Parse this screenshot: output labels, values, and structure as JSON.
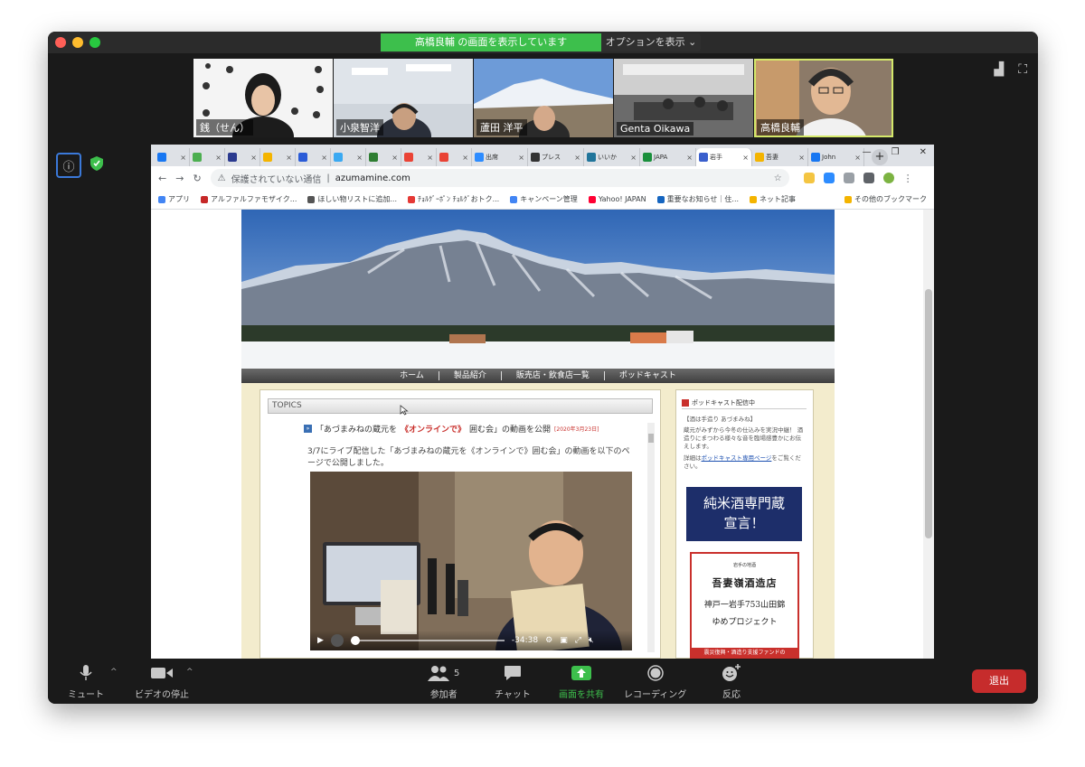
{
  "zoom": {
    "share_banner": "高橋良輔 の画面を表示しています",
    "options_label": "オプションを表示 ⌄",
    "participants": [
      {
        "name": "銭（せん）"
      },
      {
        "name": "小泉智洋"
      },
      {
        "name": "蘆田 洋平"
      },
      {
        "name": "Genta Oikawa"
      },
      {
        "name": "高橋良輔"
      }
    ],
    "toolbar": {
      "mute_label": "ミュート",
      "video_label": "ビデオの停止",
      "participants_label": "参加者",
      "participants_count": "5",
      "chat_label": "チャット",
      "share_label": "画面を共有",
      "record_label": "レコーディング",
      "react_label": "反応",
      "leave_label": "退出"
    }
  },
  "browser": {
    "tabs": [
      {
        "label": "",
        "color": "#1877f2"
      },
      {
        "label": "",
        "color": "#4caf50"
      },
      {
        "label": "",
        "color": "#2b3a8f"
      },
      {
        "label": "",
        "color": "#f4b400"
      },
      {
        "label": "",
        "color": "#2a5bd7"
      },
      {
        "label": "",
        "color": "#3aa9f2"
      },
      {
        "label": "",
        "color": "#2e7d32"
      },
      {
        "label": "",
        "color": "#ea4335"
      },
      {
        "label": "",
        "color": "#e94235"
      },
      {
        "label": "出席",
        "color": "#2d8cff"
      },
      {
        "label": "プレス",
        "color": "#333333"
      },
      {
        "label": "いいか",
        "color": "#21759b"
      },
      {
        "label": "JAPA",
        "color": "#1a8f3c"
      },
      {
        "label": "岩手",
        "color": "#3a5fcd"
      },
      {
        "label": "吾妻",
        "color": "#f4b400"
      },
      {
        "label": "John",
        "color": "#1877f2"
      }
    ],
    "security_label": "保護されていない通信",
    "url": "azumamine.com",
    "bookmarks": [
      {
        "label": "アプリ",
        "color": "#4285f4"
      },
      {
        "label": "アルファルファモザイク...",
        "color": "#c62828"
      },
      {
        "label": "ほしい物リストに追加...",
        "color": "#555555"
      },
      {
        "label": "ﾁｮﾙｸﾞｰﾎﾟﾝ ﾁｮﾙｸﾞおトク...",
        "color": "#e53935"
      },
      {
        "label": "キャンペーン管理",
        "color": "#4285f4"
      },
      {
        "label": "Yahoo! JAPAN",
        "color": "#ff0033"
      },
      {
        "label": "重要なお知らせ｜住...",
        "color": "#1565c0"
      },
      {
        "label": "ネット記事",
        "color": "#f4b400"
      },
      {
        "label": "その他のブックマーク",
        "color": "#f4b400"
      }
    ]
  },
  "site": {
    "nav": [
      "ホーム",
      "製品紹介",
      "販売店・飲食店一覧",
      "ポッドキャスト"
    ],
    "topics_label": "TOPICS",
    "article": {
      "title_pre": "「あづまみねの蔵元を",
      "title_highlight": "《オンラインで》",
      "title_post": "囲む会」の動画を公開",
      "date": "[2020年3月23日]",
      "body": "3/7にライブ配信した「あづまみねの蔵元を《オンラインで》囲む会」の動画を以下のページで公開しました。"
    },
    "video": {
      "time": "-34:38",
      "progress": 0.0
    },
    "sidebar": {
      "podcast_head": "ポッドキャスト配信中",
      "podcast_sub": "【酒は手造り あづまみね】",
      "podcast_desc": "蔵元がみずから今冬の仕込みを実況中継！ 酒造りにまつわる様々な音を臨場感豊かにお伝えします。",
      "detail_pre": "詳細は",
      "detail_link": "ポッドキャスト専用ページ",
      "detail_post": "をご覧ください。",
      "junmai_line1": "純米酒専門蔵",
      "junmai_line2": "宣言！",
      "sake_small": "岩手の地酒",
      "sake_name": "吾妻嶺酒造店",
      "sake_line1": "神戸一岩手753山田錦",
      "sake_line2": "ゆめプロジェクト",
      "sake_footer": "震災復興・酒造り支援ファンドの"
    }
  }
}
